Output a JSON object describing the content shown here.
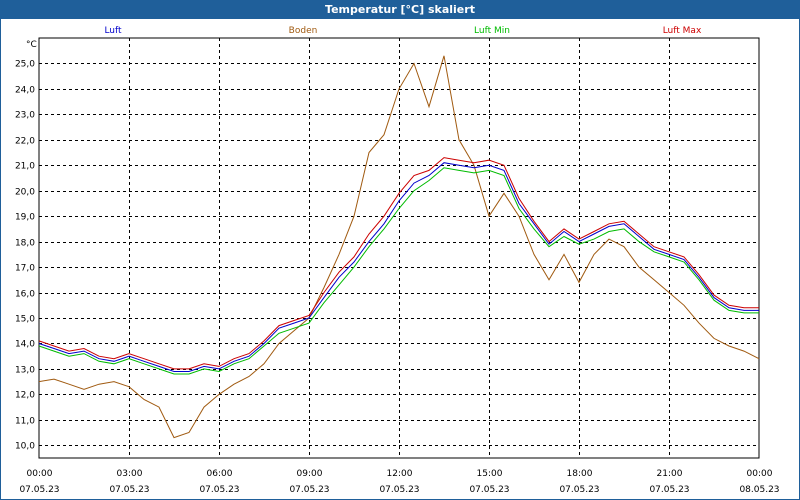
{
  "window": {
    "title": "Temperatur [°C] skaliert"
  },
  "chart_data": {
    "type": "line",
    "title": "Temperatur [°C] skaliert",
    "ylabel": "°C",
    "ylim": [
      9.5,
      26.0
    ],
    "xlim": [
      0,
      24
    ],
    "yticks": [
      10.0,
      11.0,
      12.0,
      13.0,
      14.0,
      15.0,
      16.0,
      17.0,
      18.0,
      19.0,
      20.0,
      21.0,
      22.0,
      23.0,
      24.0,
      25.0
    ],
    "ytick_labels": [
      "10,0",
      "11,0",
      "12,0",
      "13,0",
      "14,0",
      "15,0",
      "16,0",
      "17,0",
      "18,0",
      "19,0",
      "20,0",
      "21,0",
      "22,0",
      "23,0",
      "24,0",
      "25,0"
    ],
    "xticks": [
      0,
      3,
      6,
      9,
      12,
      15,
      18,
      21,
      24
    ],
    "xtick_time_labels": [
      "00:00",
      "03:00",
      "06:00",
      "09:00",
      "12:00",
      "15:00",
      "18:00",
      "21:00",
      "00:00"
    ],
    "xtick_date_labels": [
      "07.05.23",
      "07.05.23",
      "07.05.23",
      "07.05.23",
      "07.05.23",
      "07.05.23",
      "07.05.23",
      "07.05.23",
      "08.05.23"
    ],
    "grid": true,
    "legend_position": "top",
    "series": [
      {
        "name": "Luft",
        "color": "#0000cc",
        "x": [
          0,
          0.5,
          1,
          1.5,
          2,
          2.5,
          3,
          3.5,
          4,
          4.5,
          5,
          5.5,
          6,
          6.5,
          7,
          7.5,
          8,
          8.5,
          9,
          9.5,
          10,
          10.5,
          11,
          11.5,
          12,
          12.5,
          13,
          13.5,
          14,
          14.5,
          15,
          15.5,
          16,
          16.5,
          17,
          17.5,
          18,
          18.5,
          19,
          19.5,
          20,
          20.5,
          21,
          21.5,
          22,
          22.5,
          23,
          23.5,
          24
        ],
        "y": [
          14.0,
          13.8,
          13.6,
          13.7,
          13.4,
          13.3,
          13.5,
          13.3,
          13.1,
          12.9,
          12.9,
          13.1,
          13.0,
          13.3,
          13.5,
          14.0,
          14.6,
          14.8,
          15.0,
          15.8,
          16.6,
          17.2,
          18.0,
          18.7,
          19.6,
          20.3,
          20.6,
          21.1,
          21.0,
          20.9,
          21.0,
          20.8,
          19.5,
          18.7,
          17.9,
          18.4,
          18.0,
          18.3,
          18.6,
          18.7,
          18.2,
          17.7,
          17.5,
          17.3,
          16.6,
          15.8,
          15.4,
          15.3,
          15.3
        ]
      },
      {
        "name": "Boden",
        "color": "#a05a10",
        "x": [
          0,
          0.5,
          1,
          1.5,
          2,
          2.5,
          3,
          3.5,
          4,
          4.5,
          5,
          5.5,
          6,
          6.5,
          7,
          7.5,
          8,
          8.5,
          9,
          9.5,
          10,
          10.5,
          11,
          11.5,
          12,
          12.5,
          13,
          13.5,
          14,
          14.5,
          15,
          15.5,
          16,
          16.5,
          17,
          17.5,
          18,
          18.5,
          19,
          19.5,
          20,
          20.5,
          21,
          21.5,
          22,
          22.5,
          23,
          23.5,
          24
        ],
        "y": [
          12.5,
          12.6,
          12.4,
          12.2,
          12.4,
          12.5,
          12.3,
          11.8,
          11.5,
          10.3,
          10.5,
          11.5,
          12.0,
          12.4,
          12.7,
          13.2,
          14.0,
          14.5,
          15.0,
          16.2,
          17.5,
          19.0,
          21.5,
          22.2,
          24.0,
          25.0,
          23.3,
          25.3,
          22.0,
          21.0,
          19.0,
          19.9,
          19.0,
          17.5,
          16.5,
          17.5,
          16.4,
          17.5,
          18.1,
          17.8,
          17.0,
          16.5,
          16.0,
          15.5,
          14.8,
          14.2,
          13.9,
          13.7,
          13.4
        ]
      },
      {
        "name": "Luft Min",
        "color": "#00bb00",
        "x": [
          0,
          0.5,
          1,
          1.5,
          2,
          2.5,
          3,
          3.5,
          4,
          4.5,
          5,
          5.5,
          6,
          6.5,
          7,
          7.5,
          8,
          8.5,
          9,
          9.5,
          10,
          10.5,
          11,
          11.5,
          12,
          12.5,
          13,
          13.5,
          14,
          14.5,
          15,
          15.5,
          16,
          16.5,
          17,
          17.5,
          18,
          18.5,
          19,
          19.5,
          20,
          20.5,
          21,
          21.5,
          22,
          22.5,
          23,
          23.5,
          24
        ],
        "y": [
          13.9,
          13.7,
          13.5,
          13.6,
          13.3,
          13.2,
          13.4,
          13.2,
          13.0,
          12.8,
          12.8,
          13.0,
          12.9,
          13.2,
          13.4,
          13.9,
          14.4,
          14.6,
          14.8,
          15.6,
          16.3,
          17.0,
          17.8,
          18.5,
          19.3,
          20.0,
          20.4,
          20.9,
          20.8,
          20.7,
          20.8,
          20.6,
          19.3,
          18.5,
          17.8,
          18.2,
          17.9,
          18.1,
          18.4,
          18.5,
          18.0,
          17.6,
          17.4,
          17.2,
          16.5,
          15.7,
          15.3,
          15.2,
          15.2
        ]
      },
      {
        "name": "Luft Max",
        "color": "#cc0000",
        "x": [
          0,
          0.5,
          1,
          1.5,
          2,
          2.5,
          3,
          3.5,
          4,
          4.5,
          5,
          5.5,
          6,
          6.5,
          7,
          7.5,
          8,
          8.5,
          9,
          9.5,
          10,
          10.5,
          11,
          11.5,
          12,
          12.5,
          13,
          13.5,
          14,
          14.5,
          15,
          15.5,
          16,
          16.5,
          17,
          17.5,
          18,
          18.5,
          19,
          19.5,
          20,
          20.5,
          21,
          21.5,
          22,
          22.5,
          23,
          23.5,
          24
        ],
        "y": [
          14.1,
          13.9,
          13.7,
          13.8,
          13.5,
          13.4,
          13.6,
          13.4,
          13.2,
          13.0,
          13.0,
          13.2,
          13.1,
          13.4,
          13.6,
          14.1,
          14.7,
          14.9,
          15.1,
          16.0,
          16.8,
          17.4,
          18.3,
          19.0,
          19.9,
          20.6,
          20.8,
          21.3,
          21.2,
          21.1,
          21.2,
          21.0,
          19.7,
          18.8,
          18.0,
          18.5,
          18.1,
          18.4,
          18.7,
          18.8,
          18.3,
          17.8,
          17.6,
          17.4,
          16.7,
          15.9,
          15.5,
          15.4,
          15.4
        ]
      }
    ]
  }
}
